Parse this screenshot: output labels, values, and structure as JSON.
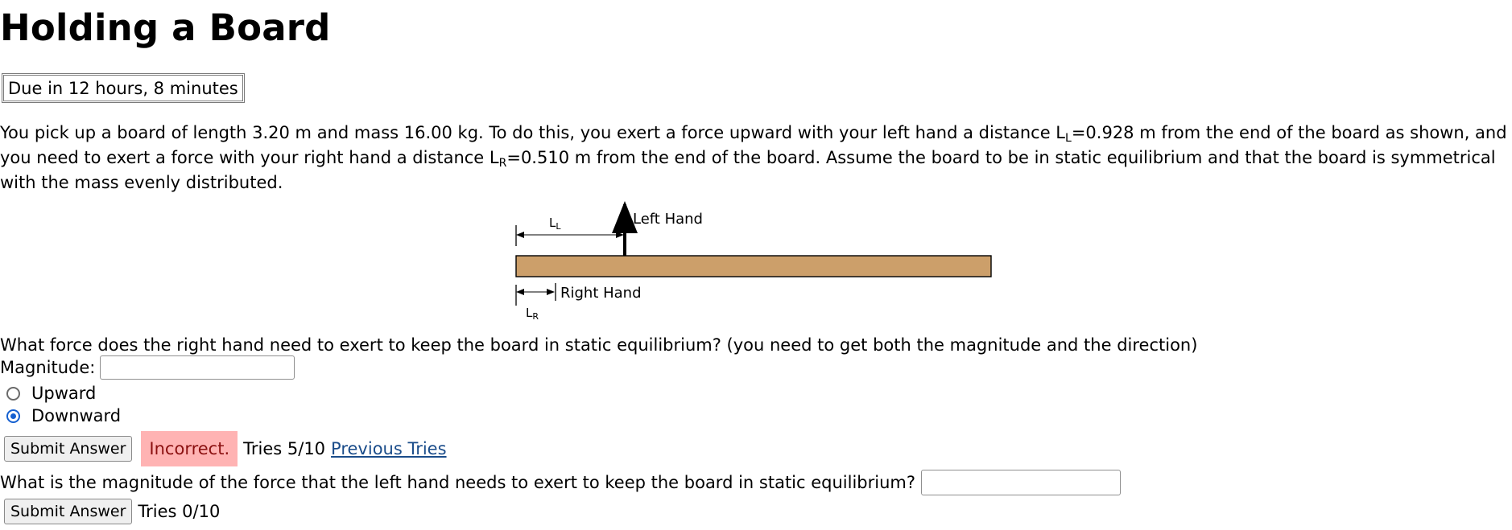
{
  "title": "Holding a Board",
  "due": "Due in 12 hours, 8 minutes",
  "problem": {
    "t1": "You pick up a board of length 3.20 m and mass 16.00 kg. To do this, you exert a force upward with your left hand a distance L",
    "sub_l": "L",
    "t2": "=0.928 m from the end of the board as shown, and you need to exert a force with your right hand a distance L",
    "sub_r": "R",
    "t3": "=0.510 m from the end of the board. Assume the board to be in static equilibrium and that the board is symmetrical with the mass evenly distributed."
  },
  "figure": {
    "ll_label": "L",
    "ll_sub": "L",
    "lr_label": "L",
    "lr_sub": "R",
    "left_hand": "Left Hand",
    "right_hand": "Right Hand",
    "board_color": "#cc9f6a"
  },
  "q1": {
    "text": "What force does the right hand need to exert to keep the board in static equilibrium? (you need to get both the magnitude and the direction)",
    "magnitude_label": "Magnitude:",
    "magnitude_value": "",
    "options": [
      "Upward",
      "Downward"
    ],
    "selected": "Downward",
    "submit": "Submit Answer",
    "status": "Incorrect.",
    "tries": "Tries 5/10",
    "previous": "Previous Tries"
  },
  "q2": {
    "text": "What is the magnitude of the force that the left hand needs to exert to keep the board in static equilibrium?",
    "value": "",
    "submit": "Submit Answer",
    "tries": "Tries 0/10"
  }
}
